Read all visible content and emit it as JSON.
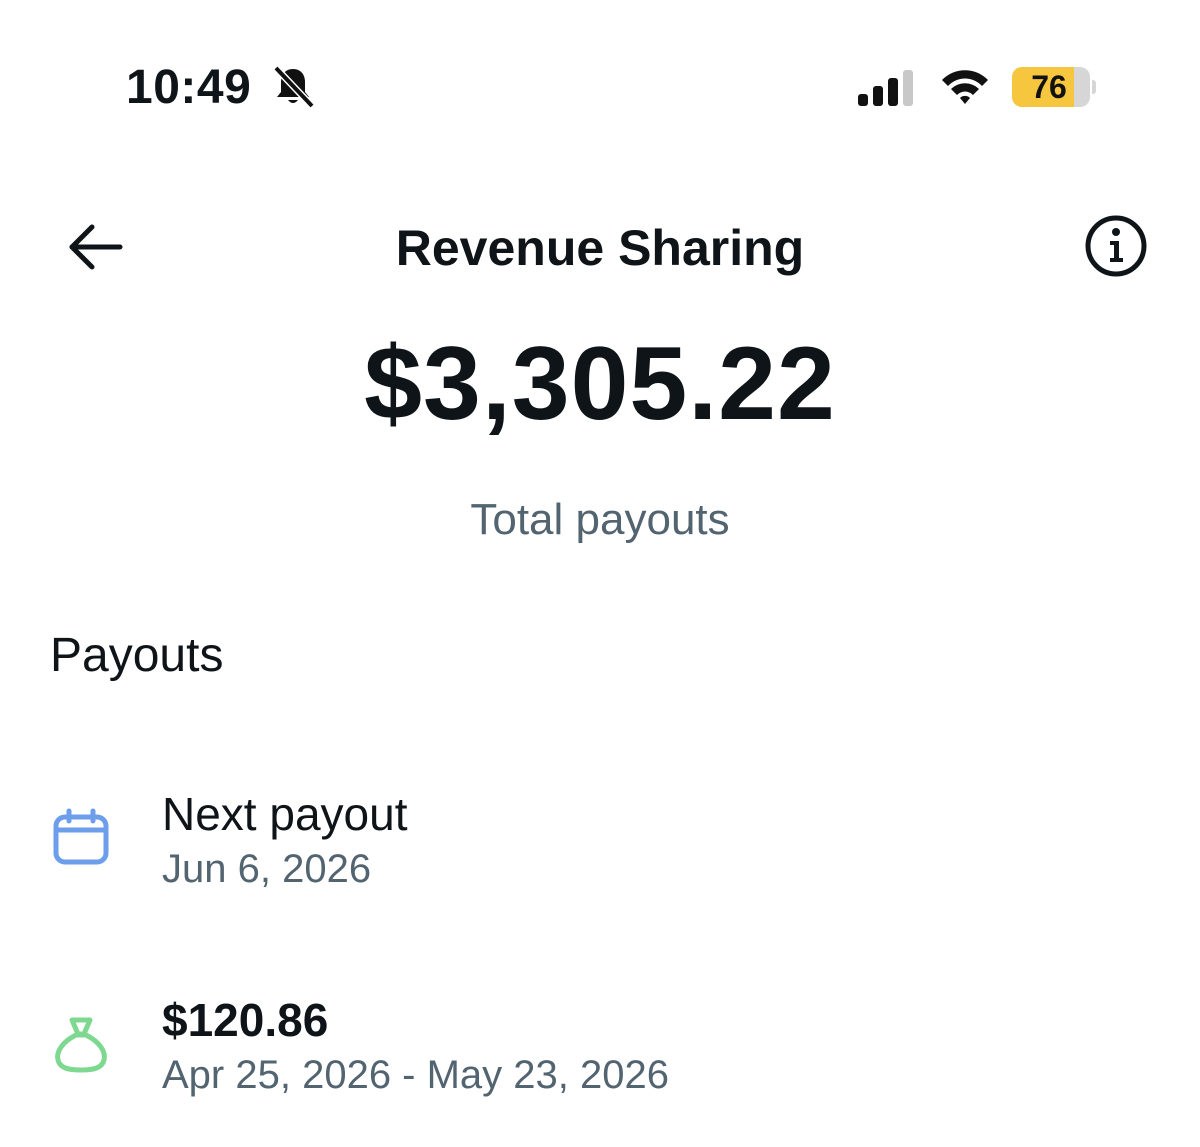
{
  "status_bar": {
    "time": "10:49",
    "battery_level": "76",
    "silent_icon": "bell-slash-icon",
    "signal_icon": "cellular-signal-icon",
    "wifi_icon": "wifi-icon",
    "battery_color": "#f5c63e"
  },
  "header": {
    "title": "Revenue Sharing",
    "back_icon": "arrow-left-icon",
    "info_icon": "info-circle-icon"
  },
  "summary": {
    "total_amount": "$3,305.22",
    "total_label": "Total payouts"
  },
  "payouts": {
    "section_title": "Payouts",
    "items": [
      {
        "icon": "calendar-icon",
        "icon_color": "#6d9eeb",
        "title": "Next payout",
        "subtitle": "Jun 6, 2026"
      },
      {
        "icon": "money-bag-icon",
        "icon_color": "#7ed88f",
        "title": "$120.86",
        "subtitle": "Apr 25, 2026 - May 23, 2026"
      }
    ]
  }
}
